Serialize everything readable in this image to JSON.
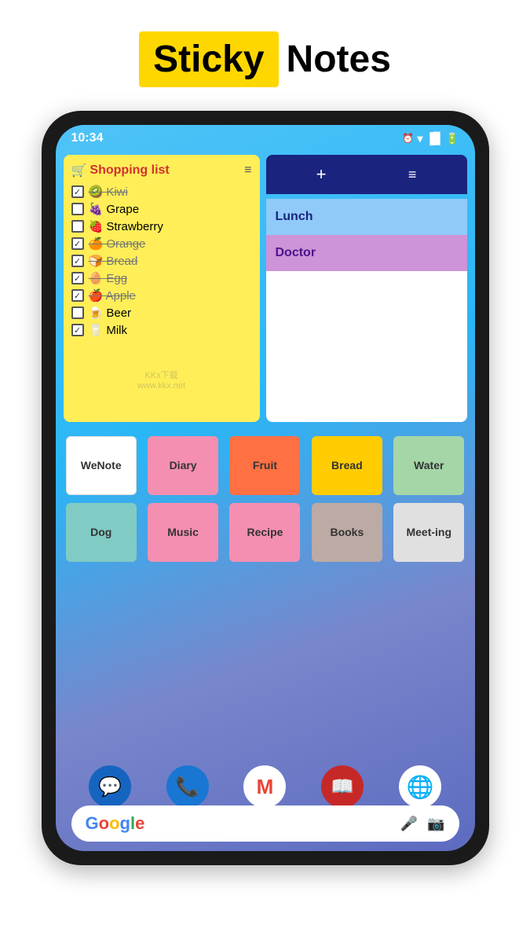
{
  "header": {
    "sticky_label": "Sticky",
    "notes_label": "Notes"
  },
  "status_bar": {
    "time": "10:34"
  },
  "shopping_note": {
    "title": "Shopping list",
    "menu_icon": "≡",
    "items": [
      {
        "text": "Kiwi",
        "emoji": "🥝",
        "checked": true,
        "strikethrough": true
      },
      {
        "text": "Grape",
        "emoji": "🍇",
        "checked": false,
        "strikethrough": false
      },
      {
        "text": "Strawberry",
        "emoji": "🍓",
        "checked": false,
        "strikethrough": false
      },
      {
        "text": "Orange",
        "emoji": "🍊",
        "checked": true,
        "strikethrough": true
      },
      {
        "text": "Bread",
        "emoji": "🍞",
        "checked": true,
        "strikethrough": true
      },
      {
        "text": "Egg",
        "emoji": "🥚",
        "checked": true,
        "strikethrough": true
      },
      {
        "text": "Apple",
        "emoji": "🍎",
        "checked": true,
        "strikethrough": true
      },
      {
        "text": "Beer",
        "emoji": "🍺",
        "checked": false,
        "strikethrough": false
      },
      {
        "text": "Milk",
        "emoji": "🥛",
        "checked": true,
        "strikethrough": false
      }
    ],
    "watermark_line1": "KKx下载",
    "watermark_line2": "www.kkx.net"
  },
  "right_panel": {
    "add_btn": "+",
    "sort_btn": "≡",
    "notes": [
      {
        "label": "Lunch",
        "color_class": "lunch"
      },
      {
        "label": "Doctor",
        "color_class": "doctor"
      }
    ]
  },
  "sticky_notes_top": [
    {
      "label": "WeNote",
      "color_class": "note-wenote"
    },
    {
      "label": "Diary",
      "color_class": "note-diary"
    },
    {
      "label": "Fruit",
      "color_class": "note-fruit"
    },
    {
      "label": "Bread",
      "color_class": "note-bread"
    },
    {
      "label": "Water",
      "color_class": "note-water"
    }
  ],
  "sticky_notes_bottom": [
    {
      "label": "Dog",
      "color_class": "note-dog"
    },
    {
      "label": "Music",
      "color_class": "note-music"
    },
    {
      "label": "Recipe",
      "color_class": "note-recipe"
    },
    {
      "label": "Books",
      "color_class": "note-books"
    },
    {
      "label": "Meeting",
      "color_class": "note-meeting"
    }
  ],
  "dock": [
    {
      "icon": "💬",
      "color_class": "dock-messages",
      "name": "messages"
    },
    {
      "icon": "📞",
      "color_class": "dock-phone",
      "name": "phone"
    },
    {
      "icon": "M",
      "color_class": "dock-gmail",
      "name": "gmail"
    },
    {
      "icon": "📖",
      "color_class": "dock-books",
      "name": "books"
    },
    {
      "icon": "◎",
      "color_class": "dock-chrome",
      "name": "chrome"
    }
  ],
  "search": {
    "google_label": "G",
    "mic_icon": "🎤",
    "lens_icon": "📷"
  }
}
